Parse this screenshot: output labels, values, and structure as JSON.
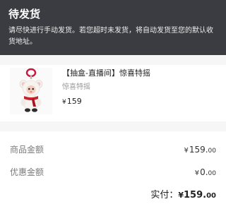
{
  "status": {
    "title": "待发货",
    "description": "请尽快进行手动发货。若您超时未发货，将自动发货至您的默认收货地址。"
  },
  "product": {
    "name": "【抽盒-直播间】惊喜特摇",
    "spec": "惊喜特摇",
    "price_currency": "¥",
    "price": "159",
    "image_icon": "plush-doll-charm-image"
  },
  "amounts": {
    "goods_label": "商品金额",
    "goods_currency": "¥",
    "goods_int": "159.",
    "goods_dec": "00",
    "discount_label": "优惠金额",
    "discount_currency": "¥",
    "discount_int": "0.",
    "discount_dec": "00",
    "paid_label": "实付：",
    "paid_currency": "¥",
    "paid_int": "159.",
    "paid_dec": "00"
  },
  "colors": {
    "banner_bg": "#3b3c41",
    "page_bg": "#f6f6f6",
    "card_bg": "#ffffff"
  }
}
